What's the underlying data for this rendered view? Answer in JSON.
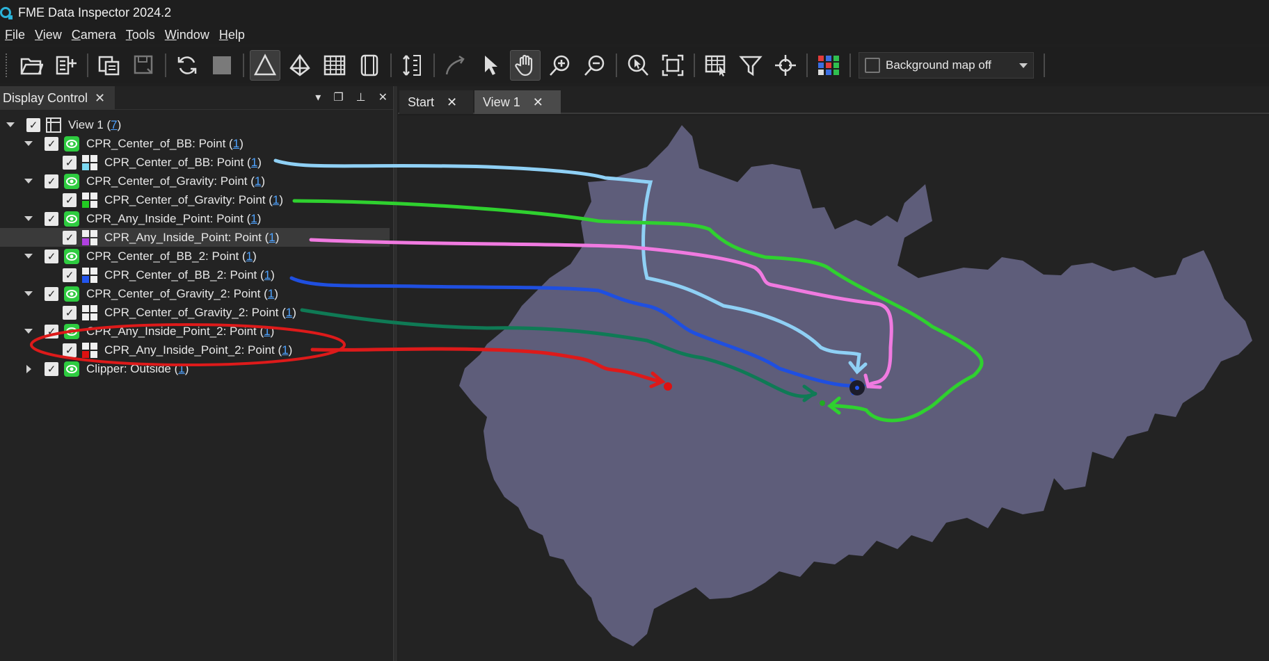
{
  "app": {
    "title": "FME Data Inspector 2024.2"
  },
  "menu": [
    "File",
    "View",
    "Camera",
    "Tools",
    "Window",
    "Help"
  ],
  "toolbar": {
    "buttons": [
      "open-icon",
      "add-dataset-icon",
      "copy-icon",
      "save-icon",
      "refresh-icon",
      "stop-icon",
      "3d-triangle-icon",
      "diamond-icon",
      "table-grid-icon",
      "view-frame-icon",
      "vertical-measure-icon",
      "curve-tool-icon",
      "select-arrow-icon",
      "pan-hand-icon",
      "zoom-in-icon",
      "zoom-out-icon",
      "zoom-select-icon",
      "zoom-extent-icon",
      "table-select-icon",
      "filter-icon",
      "crosshair-icon",
      "color-grid-icon"
    ],
    "background_map": "Background map off"
  },
  "panel": {
    "title": "Display Control",
    "tree": [
      {
        "label": "View 1 (",
        "count": "7",
        "suffix": ")",
        "level": 0,
        "icon": "view"
      },
      {
        "label": "CPR_Center_of_BB: Point (",
        "count": "1",
        "suffix": ")",
        "level": 1,
        "icon": "eye"
      },
      {
        "label": "CPR_Center_of_BB: Point (",
        "count": "1",
        "suffix": ")",
        "level": 2,
        "icon": "swatch",
        "color": "#7ad7f0"
      },
      {
        "label": "CPR_Center_of_Gravity: Point (",
        "count": "1",
        "suffix": ")",
        "level": 1,
        "icon": "eye"
      },
      {
        "label": "CPR_Center_of_Gravity: Point (",
        "count": "1",
        "suffix": ")",
        "level": 2,
        "icon": "swatch",
        "color": "#22cc22"
      },
      {
        "label": "CPR_Any_Inside_Point: Point (",
        "count": "1",
        "suffix": ")",
        "level": 1,
        "icon": "eye"
      },
      {
        "label": "CPR_Any_Inside_Point: Point (",
        "count": "1",
        "suffix": ")",
        "level": 2,
        "icon": "swatch",
        "color": "#b040e0",
        "selected": true
      },
      {
        "label": "CPR_Center_of_BB_2: Point (",
        "count": "1",
        "suffix": ")",
        "level": 1,
        "icon": "eye"
      },
      {
        "label": "CPR_Center_of_BB_2: Point (",
        "count": "1",
        "suffix": ")",
        "level": 2,
        "icon": "swatch",
        "color": "#2255ee"
      },
      {
        "label": "CPR_Center_of_Gravity_2: Point (",
        "count": "1",
        "suffix": ")",
        "level": 1,
        "icon": "eye"
      },
      {
        "label": "CPR_Center_of_Gravity_2: Point (",
        "count": "1",
        "suffix": ")",
        "level": 2,
        "icon": "swatch",
        "color": "#f0f0f0"
      },
      {
        "label": "CPR_Any_Inside_Point_2: Point (",
        "count": "1",
        "suffix": ")",
        "level": 1,
        "icon": "eye"
      },
      {
        "label": "CPR_Any_Inside_Point_2: Point (",
        "count": "1",
        "suffix": ")",
        "level": 2,
        "icon": "swatch",
        "color": "#dd1111"
      },
      {
        "label": "Clipper: Outside (",
        "count": "1",
        "suffix": ")",
        "level": 1,
        "icon": "eye",
        "collapsed": true
      }
    ]
  },
  "tabs": [
    {
      "label": "Start"
    },
    {
      "label": "View 1"
    }
  ],
  "colors": {
    "polygon": "#5e5d7a",
    "light_blue": "#8fd0f5",
    "green": "#2fd12f",
    "pink": "#f07ae0",
    "blue": "#1f4fe0",
    "dark_green": "#0f7a55",
    "red": "#dd1a1a"
  }
}
